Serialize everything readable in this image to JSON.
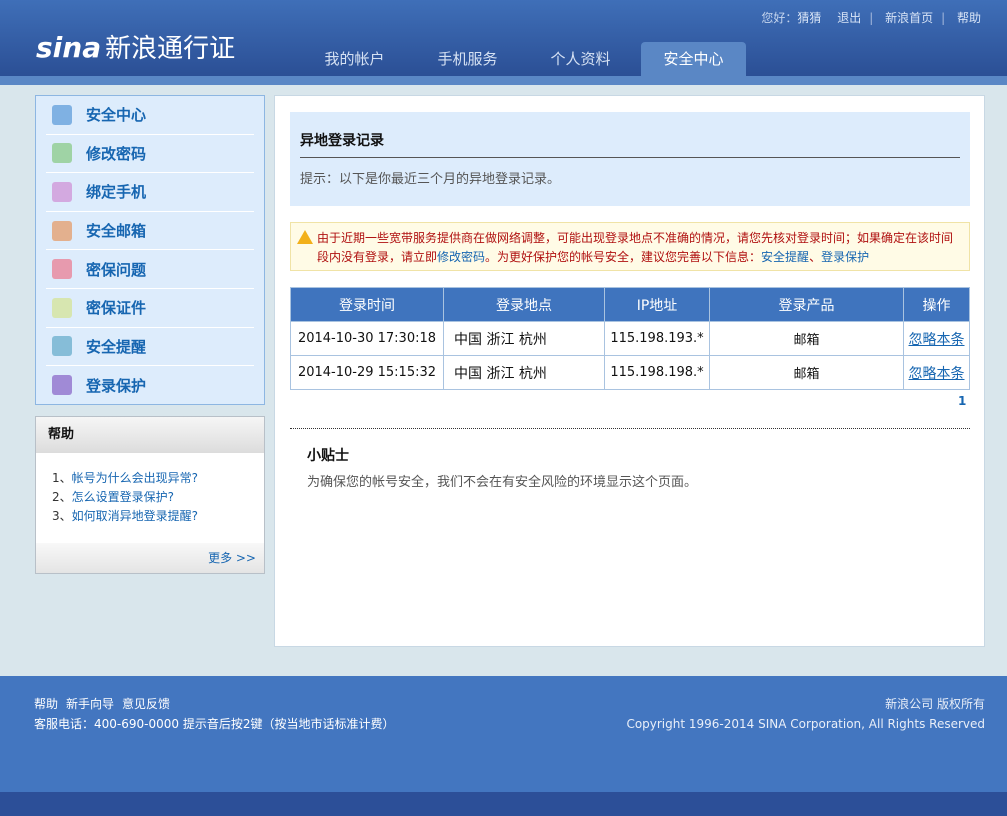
{
  "header": {
    "logo": "sina",
    "logo_text": "新浪通行证",
    "greeting": "您好：",
    "username": "猜猜",
    "logout": "退出",
    "home": "新浪首页",
    "help": "帮助",
    "tabs": [
      "我的帐户",
      "手机服务",
      "个人资料",
      "安全中心"
    ],
    "active_tab": 3
  },
  "sidebar": {
    "items": [
      {
        "label": "安全中心",
        "icon": "home-icon",
        "color": "#7fb1e3"
      },
      {
        "label": "修改密码",
        "icon": "lock-icon",
        "color": "#9fd3a5"
      },
      {
        "label": "绑定手机",
        "icon": "phone-icon",
        "color": "#d3a9e0"
      },
      {
        "label": "安全邮箱",
        "icon": "mail-icon",
        "color": "#e3b08e"
      },
      {
        "label": "密保问题",
        "icon": "edit-icon",
        "color": "#e79aae"
      },
      {
        "label": "密保证件",
        "icon": "document-icon",
        "color": "#d7e6b0"
      },
      {
        "label": "安全提醒",
        "icon": "chat-icon",
        "color": "#86bdd8"
      },
      {
        "label": "登录保护",
        "icon": "monitor-icon",
        "color": "#a08ad6"
      }
    ]
  },
  "help": {
    "title": "帮助",
    "items": [
      {
        "num": "1、",
        "text": "帐号为什么会出现异常?"
      },
      {
        "num": "2、",
        "text": "怎么设置登录保护?"
      },
      {
        "num": "3、",
        "text": "如何取消异地登录提醒?"
      }
    ],
    "more": "更多 >>"
  },
  "main": {
    "title": "异地登录记录",
    "hint": "提示：以下是你最近三个月的异地登录记录。",
    "warning": {
      "text1": "由于近期一些宽带服务提供商在做网络调整，可能出现登录地点不准确的情况，请您先核对登录时间；如果确定在该时间段内没有登录，请立即",
      "link1": "修改密码",
      "text2": "。为更好保护您的帐号安全，建议您完善以下信息：",
      "link2": "安全提醒",
      "sep": "、",
      "link3": "登录保护"
    },
    "table": {
      "headers": [
        "登录时间",
        "登录地点",
        "IP地址",
        "登录产品",
        "操作"
      ],
      "rows": [
        [
          "2014-10-30 17:30:18",
          "中国 浙江 杭州",
          "115.198.193.*",
          "邮箱",
          "忽略本条"
        ],
        [
          "2014-10-29 15:15:32",
          "中国 浙江 杭州",
          "115.198.198.*",
          "邮箱",
          "忽略本条"
        ]
      ]
    },
    "page": "1",
    "tips_title": "小贴士",
    "tips_text": "为确保您的帐号安全，我们不会在有安全风险的环境显示这个页面。"
  },
  "footer": {
    "links": [
      "帮助",
      "新手向导",
      "意见反馈"
    ],
    "phone": "客服电话：400-690-0000 提示音后按2键（按当地市话标准计费）",
    "company": "新浪公司 版权所有",
    "copyright": "Copyright 1996-2014 SINA Corporation, All Rights Reserved"
  }
}
